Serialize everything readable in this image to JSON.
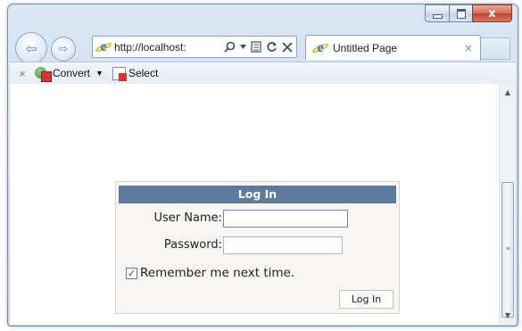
{
  "browser": {
    "address": {
      "url": "http://localhost:"
    },
    "tab": {
      "title": "Untitled Page",
      "close": "×"
    },
    "caption": {
      "close": "x"
    },
    "nav": {
      "back": "⇦",
      "forward": "⇨"
    }
  },
  "command_bar": {
    "close": "×",
    "convert_label": "Convert",
    "dropdown_caret": "▼",
    "select_label": "Select"
  },
  "login": {
    "title": "Log In",
    "username_label": "User Name:",
    "username_value": "",
    "password_label": "Password:",
    "password_value": "",
    "remember_label": "Remember me next time.",
    "remember_checked": true,
    "button_label": "Log In"
  },
  "icons": {
    "browser": "internet-explorer-icon",
    "search": "search-icon",
    "refresh": "refresh-icon",
    "stop": "stop-icon",
    "compat": "compatibility-view-icon",
    "convert": "convert-pdf-icon",
    "select": "select-pdf-icon"
  },
  "colors": {
    "login_header": "#5d7b9d",
    "login_background": "#f7f6f3",
    "window_chrome": "#cddcef",
    "close_button": "#c0432c"
  }
}
